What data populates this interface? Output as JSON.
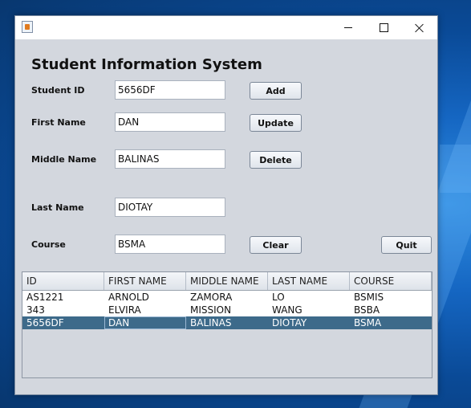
{
  "window": {
    "title": ""
  },
  "form": {
    "heading": "Student Information System",
    "student_id": {
      "label": "Student ID",
      "value": "5656DF"
    },
    "first_name": {
      "label": "First Name",
      "value": "DAN"
    },
    "middle_name": {
      "label": "Middle Name",
      "value": "BALINAS"
    },
    "last_name": {
      "label": "Last Name",
      "value": "DIOTAY"
    },
    "course": {
      "label": "Course",
      "value": "BSMA"
    }
  },
  "buttons": {
    "add": "Add",
    "update": "Update",
    "delete": "Delete",
    "clear": "Clear",
    "quit": "Quit"
  },
  "table": {
    "columns": [
      "ID",
      "FIRST NAME",
      "MIDDLE NAME",
      "LAST NAME",
      "COURSE"
    ],
    "rows": [
      [
        "AS1221",
        "ARNOLD",
        "ZAMORA",
        "LO",
        "BSMIS"
      ],
      [
        "343",
        "ELVIRA",
        "MISSION",
        "WANG",
        "BSBA"
      ],
      [
        "5656DF",
        "DAN",
        "BALINAS",
        "DIOTAY",
        "BSMA"
      ]
    ],
    "selected_row": 2
  },
  "icons": {
    "app": "java-app-icon",
    "minimize": "minimize-icon",
    "maximize": "maximize-icon",
    "close": "close-icon"
  },
  "colors": {
    "window_bg": "#d3d7de",
    "selection": "#3d6a8a",
    "desktop": "#0b4f9c"
  }
}
